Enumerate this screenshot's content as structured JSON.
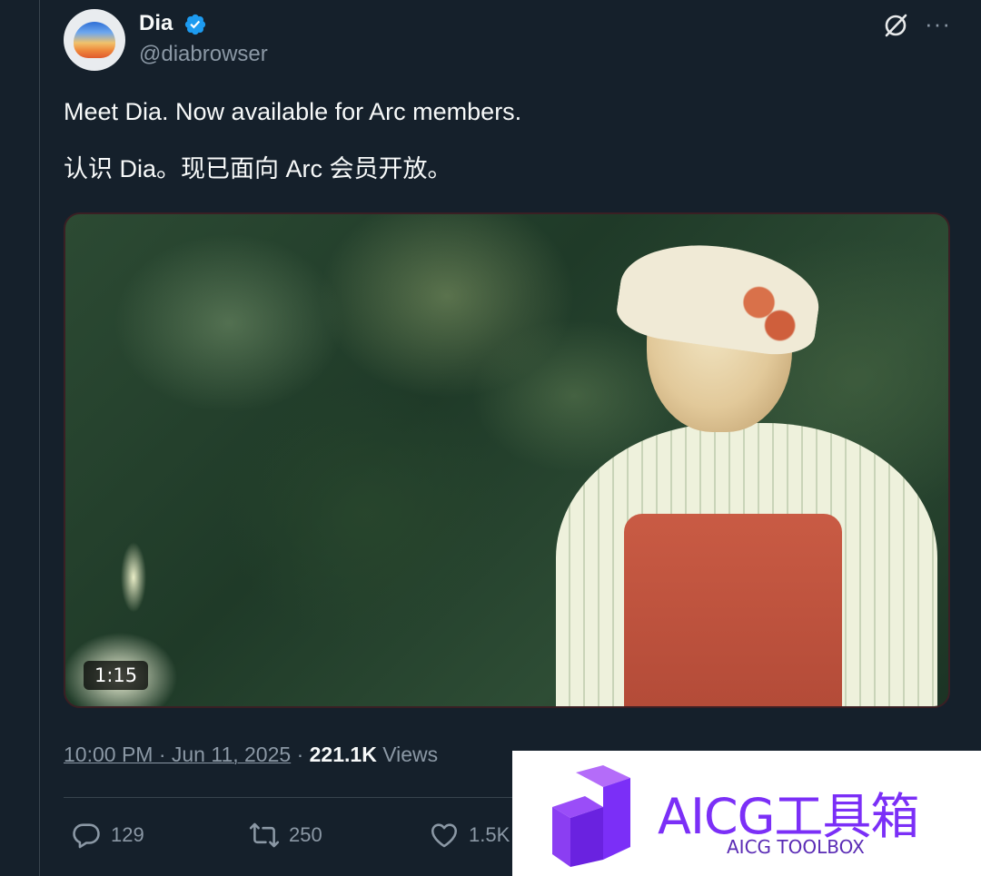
{
  "author": {
    "display_name": "Dia",
    "handle": "@diabrowser",
    "verified": true
  },
  "post": {
    "lines": [
      "Meet Dia. Now available for Arc members.",
      "认识 Dia。现已面向 Arc 会员开放。"
    ],
    "video_duration": "1:15"
  },
  "meta": {
    "timestamp": "10:00 PM · Jun 11, 2025",
    "separator": " · ",
    "views_count": "221.1K",
    "views_label": " Views"
  },
  "actions": {
    "replies": "129",
    "reposts": "250",
    "likes": "1.5K"
  },
  "watermark": {
    "title": "AICG工具箱",
    "subtitle": "AICG TOOLBOX"
  },
  "colors": {
    "background": "#15202b",
    "text": "#f7f9f9",
    "muted": "#8b98a5",
    "verified": "#1d9bf0",
    "watermark_purple": "#7b2ff7"
  },
  "icons": {
    "verified": "verified-badge-icon",
    "grok": "grok-icon",
    "more": "more-icon",
    "reply": "reply-icon",
    "repost": "repost-icon",
    "like": "like-icon"
  }
}
